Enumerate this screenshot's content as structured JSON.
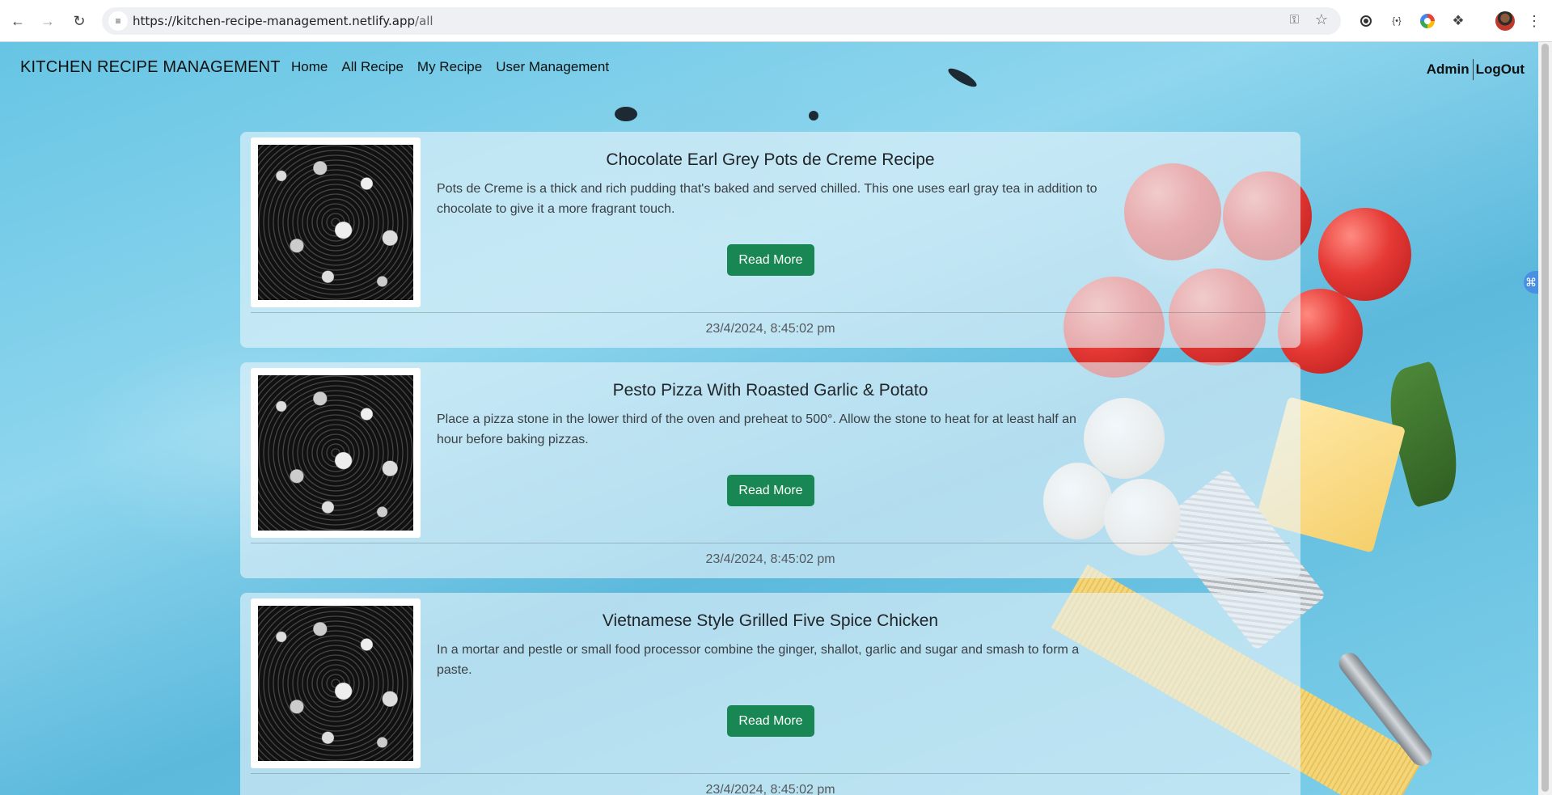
{
  "browser": {
    "url_host": "https://kitchen-recipe-management.netlify.app",
    "url_path": "/all",
    "back_glyph": "←",
    "forward_glyph": "→",
    "reload_glyph": "↻",
    "site_info_glyph": "≡",
    "key_glyph": "⚿",
    "star_glyph": "☆",
    "ext_code_glyph": "{•}",
    "ext_puzzle_glyph": "❖",
    "menu_glyph": "⋮"
  },
  "header": {
    "brand": "KITCHEN RECIPE MANAGEMENT",
    "nav": [
      "Home",
      "All Recipe",
      "My Recipe",
      "User Management"
    ],
    "admin": "Admin",
    "logout": "LogOut"
  },
  "side_widget_glyph": "⌘",
  "recipes": [
    {
      "title": "Chocolate Earl Grey Pots de Creme Recipe",
      "description": "Pots de Creme is a thick and rich pudding that's baked and served chilled. This one uses earl gray tea in addition to chocolate to give it a more fragrant touch.",
      "button": "Read More",
      "date": "23/4/2024, 8:45:02 pm"
    },
    {
      "title": "Pesto Pizza With Roasted Garlic & Potato",
      "description": "Place a pizza stone in the lower third of the oven and preheat to 500°. Allow the stone to heat for at least half an hour before baking pizzas.",
      "button": "Read More",
      "date": "23/4/2024, 8:45:02 pm"
    },
    {
      "title": "Vietnamese Style Grilled Five Spice Chicken",
      "description": "In a mortar and pestle or small food processor combine the ginger, shallot, garlic and sugar and smash to form a paste.",
      "button": "Read More",
      "date": "23/4/2024, 8:45:02 pm"
    }
  ],
  "colors": {
    "button_green": "#198754",
    "page_blue": "#7fd0ea"
  }
}
